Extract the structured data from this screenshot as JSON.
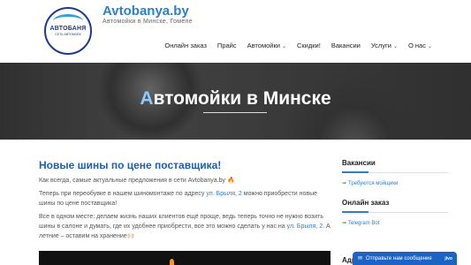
{
  "logo": {
    "text": "АВТОБАНЯ",
    "subtext": "СЕТЬ АВТОМОЕК"
  },
  "site": {
    "title": "Avtobanya.by",
    "description": "Автомойки в Минске, Гомеле"
  },
  "nav": {
    "items": [
      {
        "label": "Онлайн заказ",
        "dropdown": false
      },
      {
        "label": "Прайс",
        "dropdown": false
      },
      {
        "label": "Автомойки",
        "dropdown": true
      },
      {
        "label": "Скидки!",
        "dropdown": false
      },
      {
        "label": "Вакансии",
        "dropdown": false
      },
      {
        "label": "Услуги",
        "dropdown": true
      },
      {
        "label": "О нас",
        "dropdown": true
      }
    ]
  },
  "hero": {
    "title_first": "А",
    "title_rest": "втомойки в Минске"
  },
  "post": {
    "title": "Новые шины по цене поставщика!",
    "p1": "Как всегда, самые актуальные предложения в сети Avtobanya.by 🔥",
    "p2_before": "Теперь при переобувке в нашем шиномонтаже по адресу ",
    "p2_link": "ул. Брыля, 2",
    "p2_after": " можно приобрести новые шины по цене поставщика!",
    "p3_before": "Все в одном месте: делаем жизнь наших клиентов ещё проще, ведь теперь точно не нужно возить шины в салоне и думать, где их удобнее приобрести, все это можно сделать у нас на ",
    "p3_link": "ул. Брыля, 2",
    "p3_after": ". А летние – оставим на хранение🙌🏻"
  },
  "sidebar": {
    "widgets": [
      {
        "title": "Вакансии",
        "link": "Требуются мойщики"
      },
      {
        "title": "Онлайн заказ",
        "link": "Telegram Bot"
      }
    ],
    "partial_title": "Адр"
  },
  "chat": {
    "label": "Отправьте нам сообщение",
    "badge": "jivo"
  },
  "colors": {
    "brand": "#2c7fc8",
    "heading": "#1a5fb4",
    "chat": "#1c63c4"
  }
}
